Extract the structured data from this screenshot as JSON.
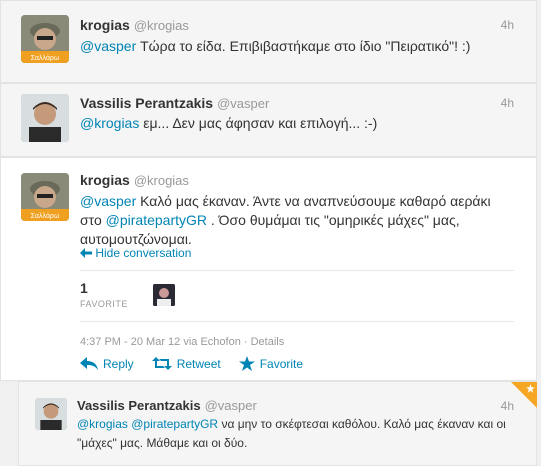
{
  "tweets": [
    {
      "name": "krogias",
      "handle": "@krogias",
      "time": "4h",
      "mention": "@vasper",
      "text": " Τώρα το είδα. Επιβιβαστήκαμε στο ίδιο \"Πειρατικό\"! :)",
      "avatar_caption": "Σαλλάρω"
    },
    {
      "name": "Vassilis Perantzakis",
      "handle": "@vasper",
      "time": "4h",
      "mention": "@krogias",
      "text": " εμ... Δεν μας άφησαν και επιλογή... :-)"
    },
    {
      "name": "krogias",
      "handle": "@krogias",
      "mention1": "@vasper",
      "text1": " Καλό μας έκαναν. Άντε να αναπνεύσουμε καθαρό αεράκι",
      "text2a": "στο ",
      "mention2": "@piratepartyGR",
      "text2b": " . Όσο θυμάμαι τις \"ομηρικές μάχες\" μας,",
      "text3": "αυτομουτζώνομαι.",
      "avatar_caption": "Σαλλάρω",
      "hide_conversation": "Hide conversation",
      "favorite_count": "1",
      "favorite_label": "FAVORITE",
      "meta": "4:37 PM - 20 Mar 12 via Echofon · Details",
      "actions": {
        "reply": "Reply",
        "retweet": "Retweet",
        "favorite": "Favorite"
      }
    },
    {
      "name": "Vassilis Perantzakis",
      "handle": "@vasper",
      "time": "4h",
      "mention1": "@krogias",
      "mention2": "@piratepartyGR",
      "text1": " να μην το σκέφτεσαι καθόλου. Καλό μας έκαναν και οι",
      "text2": "\"μάχες\" μας. Μάθαμε και οι δύο."
    }
  ],
  "colors": {
    "link": "#0084b4",
    "favorite_corner": "#f5a623"
  }
}
